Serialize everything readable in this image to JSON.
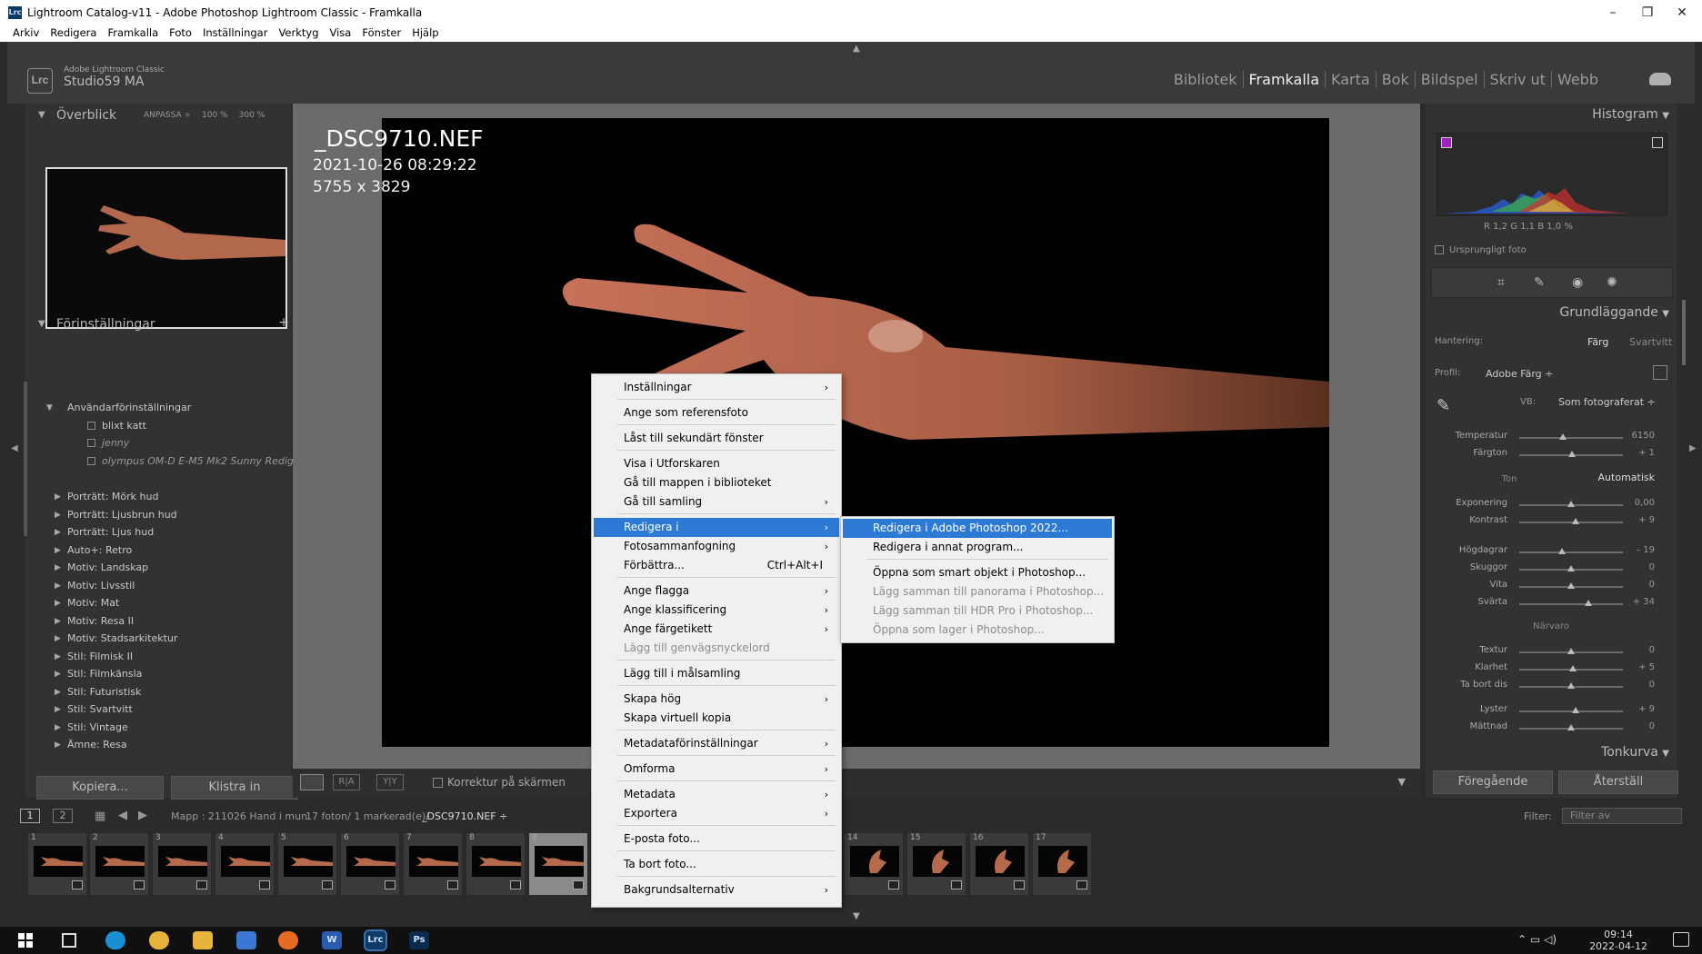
{
  "window": {
    "title": "Lightroom Catalog-v11 - Adobe Photoshop Lightroom Classic - Framkalla",
    "logo_small": "Lrc",
    "controls": [
      "–",
      "❐",
      "✕"
    ]
  },
  "menubar": [
    "Arkiv",
    "Redigera",
    "Framkalla",
    "Foto",
    "Inställningar",
    "Verktyg",
    "Visa",
    "Fönster",
    "Hjälp"
  ],
  "identity": {
    "logo": "Lrc",
    "app_small": "Adobe Lightroom Classic",
    "name": "Studio59 MA"
  },
  "modules": [
    {
      "label": "Bibliotek",
      "active": false
    },
    {
      "label": "Framkalla",
      "active": true
    },
    {
      "label": "Karta",
      "active": false
    },
    {
      "label": "Bok",
      "active": false
    },
    {
      "label": "Bildspel",
      "active": false
    },
    {
      "label": "Skriv ut",
      "active": false
    },
    {
      "label": "Webb",
      "active": false
    }
  ],
  "left": {
    "navigator": {
      "title": "Överblick",
      "opt1": "ANPASSA ÷",
      "opt2": "100 %",
      "opt3": "300 %"
    },
    "presets": {
      "title": "Förinställningar",
      "add": "+",
      "user_group": "Användarförinställningar",
      "user_items": [
        "blixt katt",
        "jenny",
        "olympus OM-D E-M5 Mk2 Sunny Redigerad"
      ],
      "groups": [
        "Porträtt: Mörk hud",
        "Porträtt: Ljusbrun hud",
        "Porträtt: Ljus hud",
        "Auto+: Retro",
        "Motiv: Landskap",
        "Motiv: Livsstil",
        "Motiv: Mat",
        "Motiv: Resa II",
        "Motiv: Stadsarkitektur",
        "Stil: Filmisk II",
        "Stil: Filmkänsla",
        "Stil: Futuristisk",
        "Stil: Svartvitt",
        "Stil: Vintage",
        "Ämne: Resa"
      ]
    },
    "copy_btn": "Kopiera...",
    "paste_btn": "Klistra in"
  },
  "photo": {
    "filename": "_DSC9710.NEF",
    "datetime": "2021-10-26 08:29:22",
    "dimensions": "5755 x 3829"
  },
  "toolbar": {
    "proof_label": "Korrektur på skärmen"
  },
  "right": {
    "histogram_title": "Histogram",
    "hist_values": "R  1,2  G  1,1  B  1,0 %",
    "original_photo": "Ursprungligt foto",
    "basic_title": "Grundläggande",
    "treatment_label": "Hantering:",
    "color_label": "Färg",
    "bw_label": "Svartvitt",
    "profile_label": "Profil:",
    "profile_value": "Adobe Färg ÷",
    "wb_label": "VB:",
    "wb_value": "Som fotograferat ÷",
    "tone_label": "Ton",
    "auto_label": "Automatisk",
    "presence_label": "Närvaro",
    "sliders": [
      {
        "label": "Temperatur",
        "value": "6150",
        "pos": 0.42
      },
      {
        "label": "Färgton",
        "value": "+ 1",
        "pos": 0.51
      },
      {
        "label": "Exponering",
        "value": "0,00",
        "pos": 0.5
      },
      {
        "label": "Kontrast",
        "value": "+ 9",
        "pos": 0.54
      },
      {
        "label": "Högdagrar",
        "value": "– 19",
        "pos": 0.41
      },
      {
        "label": "Skuggor",
        "value": "0",
        "pos": 0.5
      },
      {
        "label": "Vita",
        "value": "0",
        "pos": 0.5
      },
      {
        "label": "Svärta",
        "value": "+ 34",
        "pos": 0.67
      },
      {
        "label": "Textur",
        "value": "0",
        "pos": 0.5
      },
      {
        "label": "Klarhet",
        "value": "+ 5",
        "pos": 0.52
      },
      {
        "label": "Ta bort dis",
        "value": "0",
        "pos": 0.5
      },
      {
        "label": "Lyster",
        "value": "+ 9",
        "pos": 0.54
      },
      {
        "label": "Mättnad",
        "value": "0",
        "pos": 0.5
      }
    ],
    "tone_curve_title": "Tonkurva",
    "prev_btn": "Föregående",
    "reset_btn": "Återställ"
  },
  "filmstrip_bar": {
    "screen1": "1",
    "screen2": "2",
    "source": "Mapp : 211026 Hand i mun",
    "count": "17 foton/  1 markerad(e)/",
    "current": "_DSC9710.NEF ÷",
    "filter_label": "Filter:",
    "filter_value": "Filter av"
  },
  "filmstrip": {
    "thumbs": [
      "1",
      "2",
      "3",
      "4",
      "5",
      "6",
      "7",
      "8",
      "9",
      "14",
      "15",
      "16",
      "17"
    ],
    "selected": "9"
  },
  "context_menu": {
    "items": [
      {
        "label": "Inställningar",
        "arrow": true
      },
      {
        "label": "Ange som referensfoto"
      },
      {
        "label": "Låst till sekundärt fönster"
      },
      {
        "label": "Visa i Utforskaren"
      },
      {
        "label": "Gå till mappen i biblioteket"
      },
      {
        "label": "Gå till samling",
        "arrow": true
      },
      {
        "label": "Redigera i",
        "arrow": true,
        "highlight": true
      },
      {
        "label": "Fotosammanfogning",
        "arrow": true
      },
      {
        "label": "Förbättra...",
        "shortcut": "Ctrl+Alt+I"
      },
      {
        "label": "Ange flagga",
        "arrow": true
      },
      {
        "label": "Ange klassificering",
        "arrow": true
      },
      {
        "label": "Ange färgetikett",
        "arrow": true
      },
      {
        "label": "Lägg till genvägsnyckelord",
        "disabled": true
      },
      {
        "label": "Lägg till i målsamling"
      },
      {
        "label": "Skapa hög",
        "arrow": true
      },
      {
        "label": "Skapa virtuell kopia"
      },
      {
        "label": "Metadataförinställningar",
        "arrow": true
      },
      {
        "label": "Omforma",
        "arrow": true
      },
      {
        "label": "Metadata",
        "arrow": true
      },
      {
        "label": "Exportera",
        "arrow": true
      },
      {
        "label": "E-posta foto..."
      },
      {
        "label": "Ta bort foto..."
      },
      {
        "label": "Bakgrundsalternativ",
        "arrow": true
      }
    ],
    "arrow_glyph": "›"
  },
  "submenu": {
    "items": [
      {
        "label": "Redigera i Adobe Photoshop 2022...",
        "highlight": true
      },
      {
        "label": "Redigera i annat program..."
      },
      {
        "label": "Öppna som smart objekt i Photoshop..."
      },
      {
        "label": "Lägg samman till panorama i Photoshop...",
        "disabled": true
      },
      {
        "label": "Lägg samman till HDR Pro i Photoshop...",
        "disabled": true
      },
      {
        "label": "Öppna som lager i Photoshop...",
        "disabled": true
      }
    ]
  },
  "taskbar": {
    "time": "09:14",
    "date": "2022-04-12",
    "apps": [
      {
        "name": "edge",
        "color": "#1b8fd6"
      },
      {
        "name": "chrome",
        "color": "#e8b33a"
      },
      {
        "name": "explorer",
        "color": "#e7b43c"
      },
      {
        "name": "store",
        "color": "#3a78d4"
      },
      {
        "name": "firefox",
        "color": "#e66a22"
      },
      {
        "name": "word",
        "color": "#2b5bb0"
      },
      {
        "name": "lightroom",
        "color": "#0e3a66"
      },
      {
        "name": "photoshop",
        "color": "#0a2a4e"
      }
    ],
    "lrc_label": "Lrc",
    "ps_label": "Ps",
    "w_label": "W"
  },
  "colors": {
    "menu_highlight": "#2d7ad6",
    "panel": "#323232",
    "center_bg": "#6b6b6b"
  }
}
